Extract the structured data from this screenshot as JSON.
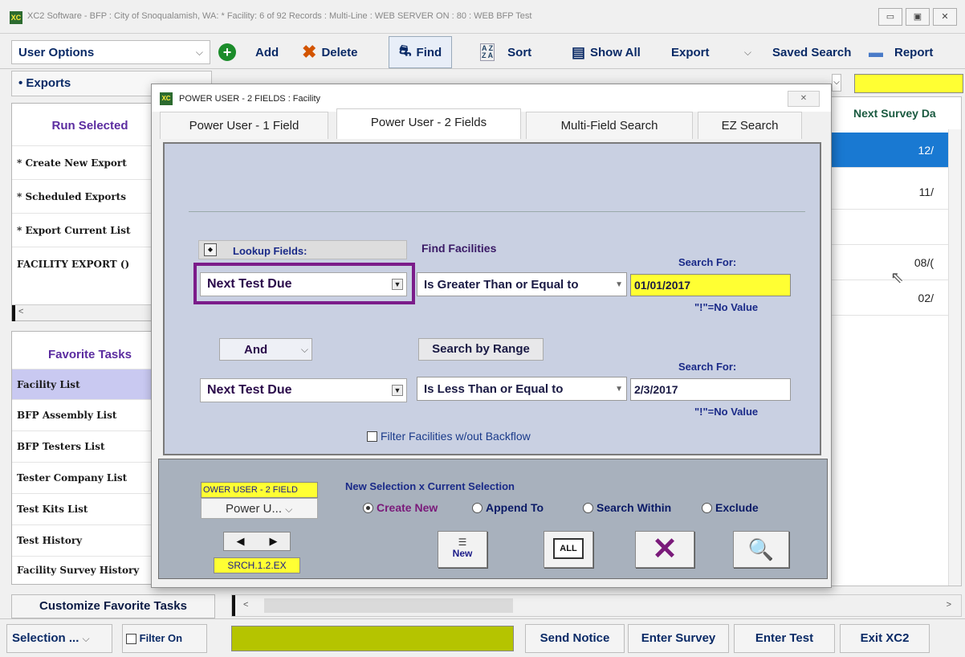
{
  "window": {
    "title": "XC2 Software - BFP : City of Snoqualamish, WA: * Facility: 6 of 92 Records : Multi-Line : WEB SERVER ON : 80 : WEB BFP Test",
    "controls": [
      "▭",
      "▣",
      "✕"
    ]
  },
  "toolbar": {
    "user_options": "User Options",
    "add": "Add",
    "delete": "Delete",
    "find": "Find",
    "sort": "Sort",
    "show_all": "Show All",
    "export": "Export",
    "saved_search": "Saved Search",
    "report": "Report"
  },
  "exports_label": "• Exports",
  "left_panel": {
    "run_selected": "Run Selected",
    "items": [
      "* Create New Export",
      "* Scheduled Exports",
      "* Export Current List",
      "FACILITY EXPORT ()"
    ],
    "favorite_tasks": "Favorite Tasks",
    "favorites": [
      "Facility List",
      "BFP Assembly List",
      "BFP Testers List",
      "Tester Company List",
      "Test Kits List",
      "Test History",
      "Facility Survey History"
    ],
    "customize": "Customize Favorite Tasks"
  },
  "grid": {
    "header": "Next Survey Da",
    "values": [
      "12/",
      "11/",
      "",
      "08/(",
      "02/"
    ]
  },
  "bottom": {
    "selection": "Selection ...",
    "filter_on": "Filter On",
    "send_notice": "Send Notice",
    "enter_survey": "Enter Survey",
    "enter_test": "Enter Test",
    "exit": "Exit XC2"
  },
  "dialog": {
    "title": "POWER USER - 2 FIELDS : Facility",
    "tabs": [
      "Power User - 1 Field",
      "Power User - 2 Fields",
      "Multi-Field Search",
      "EZ Search"
    ],
    "lookup_label": "Lookup Fields:",
    "find_label": "Find Facilities",
    "search_for": "Search For:",
    "field1": "Next Test Due",
    "op1": "Is Greater Than or Equal to",
    "value1": "01/01/2017",
    "no_value": "\"!\"=No Value",
    "conj": "And",
    "range_btn": "Search by Range",
    "field2": "Next Test Due",
    "op2": "Is Less Than or Equal to",
    "value2": "2/3/2017",
    "filter_label": "Filter Facilities w/out Backflow",
    "mode_label": "OWER USER - 2 FIELD",
    "mode_select": "Power U...",
    "code": "SRCH.1.2.EX",
    "new_selection": "New Selection x Current Selection",
    "radios": [
      "Create New",
      "Append To",
      "Search Within",
      "Exclude"
    ],
    "btn_new": "New",
    "btn_all": "ALL"
  }
}
